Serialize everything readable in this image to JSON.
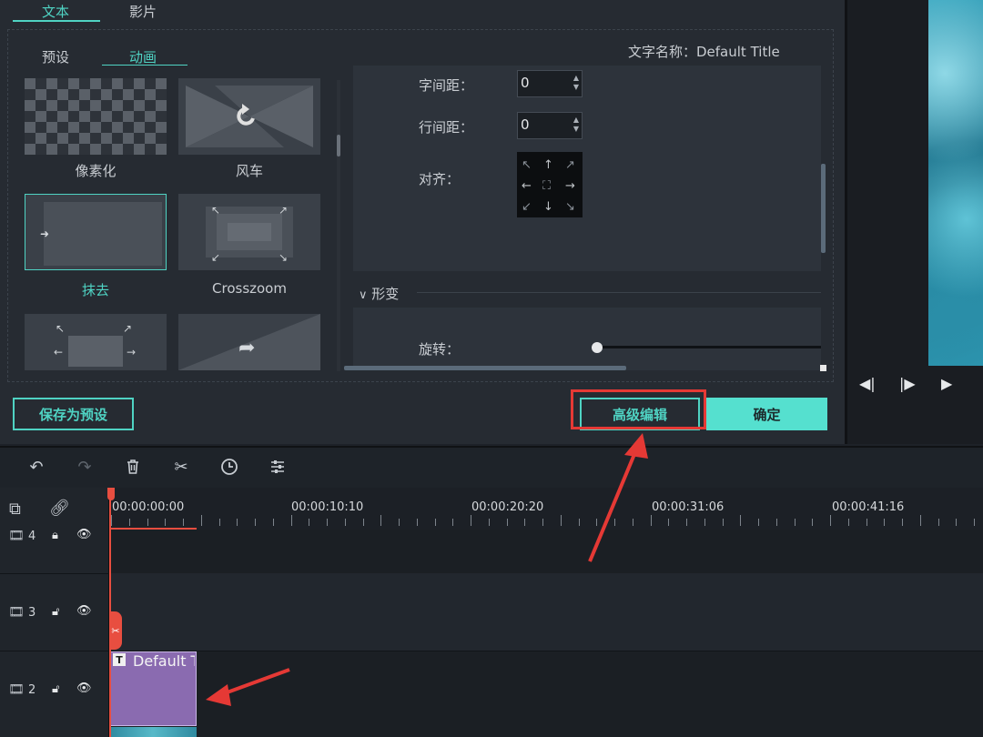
{
  "editor": {
    "tabs": [
      {
        "label": "文本"
      },
      {
        "label": "影片"
      }
    ],
    "subtabs": [
      {
        "label": "预设"
      },
      {
        "label": "动画"
      }
    ],
    "title_name": "文字名称：Default Title",
    "animations": [
      {
        "label": "像素化"
      },
      {
        "label": "风车"
      },
      {
        "label": "抹去"
      },
      {
        "label": "Crosszoom"
      },
      {
        "label": ""
      },
      {
        "label": ""
      }
    ],
    "properties": {
      "letter_spacing_label": "字间距：",
      "letter_spacing_value": "0",
      "line_spacing_label": "行间距：",
      "line_spacing_value": "0",
      "align_label": "对齐：",
      "transform_header": "形变",
      "rotation_label": "旋转："
    },
    "buttons": {
      "save_preset": "保存为预设",
      "advanced_edit": "高级编辑",
      "ok": "确定"
    }
  },
  "preview": {
    "controls": [
      "◀|",
      "|▶",
      "▶"
    ]
  },
  "timeline": {
    "timecodes": [
      "00:00:00:00",
      "00:00:10:10",
      "00:00:20:20",
      "00:00:31:06",
      "00:00:41:16"
    ],
    "tracks": [
      {
        "number": "4"
      },
      {
        "number": "3"
      },
      {
        "number": "2"
      }
    ],
    "title_clip_label": "Default T",
    "video_clip_label": "…"
  },
  "colors": {
    "accent": "#4fd3c3",
    "highlight": "#e53935",
    "clip": "#8a6bb0",
    "playhead": "#e84e40"
  }
}
